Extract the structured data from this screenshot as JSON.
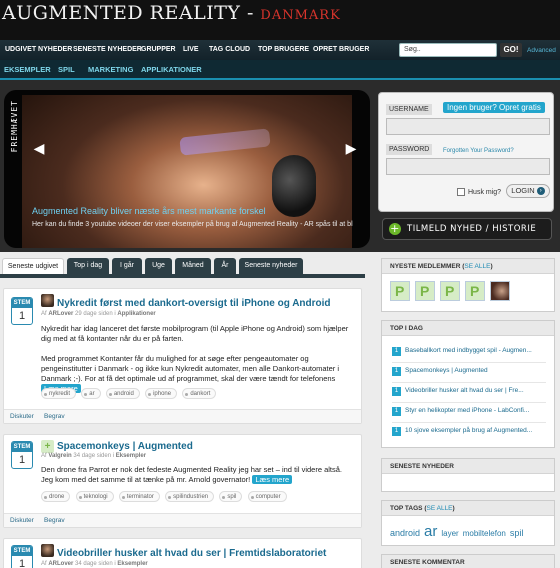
{
  "site": {
    "title": "AUGMENTED REALITY",
    "separator": " - ",
    "country": "DANMARK"
  },
  "top_nav": [
    "UDGIVET NYHEDER",
    "SENESTE NYHEDER",
    "GRUPPER",
    "LIVE",
    "TAG CLOUD",
    "TOP BRUGERE",
    "OPRET BRUGER"
  ],
  "search": {
    "value": "Søg..",
    "button": "GO!",
    "advanced": "Advanced"
  },
  "sub_nav": [
    "EKSEMPLER",
    "SPIL",
    "MARKETING",
    "APPLIKATIONER"
  ],
  "featured": {
    "label": "FREMHÆVET",
    "title": "Augmented Reality bliver næste års mest markante forskel",
    "description": "Her kan du finde 3 youtube videoer der viser eksempler på brug af Augmented Reality - AR spås til at bl"
  },
  "login": {
    "username_label": "USERNAME",
    "register_link": "Ingen bruger? Opret gratis",
    "password_label": "PASSWORD",
    "forgot_link": "Forgotten Your Password?",
    "remember_label": "Husk mig?",
    "login_button": "LOGIN"
  },
  "submit_button": "TILMELD NYHED / HISTORIE",
  "tabs": [
    "Seneste udgivet",
    "Top i dag",
    "I går",
    "Uge",
    "Måned",
    "År",
    "Seneste nyheder"
  ],
  "posts": [
    {
      "stem_label": "STEM",
      "votes": "1",
      "title": "Nykredit først med dankort-oversigt til iPhone og Android",
      "meta_prefix": "Af ",
      "author": "ARLover",
      "meta_middle": " 29 dage siden i ",
      "category": "Applikationer",
      "paragraphs": [
        "Nykredit har idag lanceret det første mobilprogram (til Apple iPhone og Android) som hjælper dig med at få kontanter når du er på farten.",
        "Med programmet Kontanter får du mulighed for at søge efter pengeautomater og pengeinstitutter i Danmark - og ikke kun Nykredit automater, men alle Dankort-automater i Danmark ;-). For at få det optimale ud af programmet, skal der være tændt for telefonens"
      ],
      "more": "Læs mere",
      "tags": [
        "nykredit",
        "ar",
        "android",
        "iphone",
        "dankort"
      ],
      "footer": [
        "Diskuter",
        "Begrav"
      ]
    },
    {
      "stem_label": "STEM",
      "votes": "1",
      "title": "Spacemonkeys | Augmented",
      "meta_prefix": "Af ",
      "author": "Valgrein",
      "meta_middle": " 34 dage siden i ",
      "category": "Eksempler",
      "paragraphs": [
        "Den drone fra Parrot er nok det fedeste Augmented Reality jeg har set – ind til videre altså. Jeg kom med det samme til at tænke på mr. Arnold governator!"
      ],
      "more": "Læs mere",
      "tags": [
        "drone",
        "teknologi",
        "terminator",
        "spilindustrien",
        "spil",
        "computer"
      ],
      "footer": [
        "Diskuter",
        "Begrav"
      ]
    },
    {
      "stem_label": "STEM",
      "votes": "1",
      "title": "Videobriller husker alt hvad du ser | Fremtidslaboratoriet",
      "meta_prefix": "Af ",
      "author": "ARLover",
      "meta_middle": " 34 dage siden i ",
      "category": "Eksempler"
    }
  ],
  "sidebar": {
    "members_title": "NYESTE MEDLEMMER",
    "members_link": "SE ALLE",
    "member_placeholder": "P",
    "topday_title": "TOP I DAG",
    "topday": [
      {
        "rank": "1",
        "text": "Baseballkort med indbygget spil - Augmen..."
      },
      {
        "rank": "1",
        "text": "Spacemonkeys | Augmented"
      },
      {
        "rank": "1",
        "text": "Videobriller husker alt hvad du ser | Fre..."
      },
      {
        "rank": "1",
        "text": "Styr en helikopter med iPhone - LabConfi..."
      },
      {
        "rank": "1",
        "text": "10 sjove eksempler på brug af Augmented..."
      }
    ],
    "news_title": "SENESTE NYHEDER",
    "tags_title": "TOP TAGS",
    "tags_link": "SE ALLE",
    "cloud": [
      {
        "text": "android",
        "size": "9px"
      },
      {
        "text": "ar",
        "size": "15px"
      },
      {
        "text": "layer",
        "size": "8px"
      },
      {
        "text": "mobiltelefon",
        "size": "8px"
      },
      {
        "text": "spil",
        "size": "9px"
      }
    ],
    "comments_title": "SENESTE KOMMENTAR"
  }
}
